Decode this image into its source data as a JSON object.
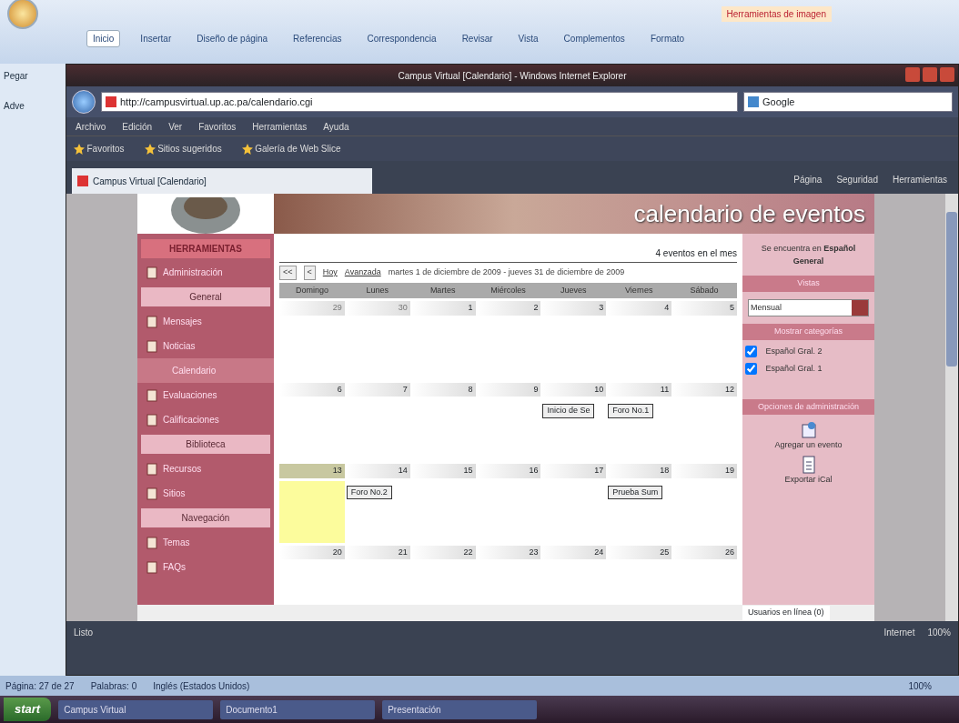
{
  "word": {
    "ribbon_tabs": [
      {
        "label": "Inicio",
        "selected": true
      },
      {
        "label": "Insertar",
        "selected": false
      },
      {
        "label": "Diseño de página",
        "selected": false
      },
      {
        "label": "Referencias",
        "selected": false
      },
      {
        "label": "Correspondencia",
        "selected": false
      },
      {
        "label": "Revisar",
        "selected": false
      },
      {
        "label": "Vista",
        "selected": false
      },
      {
        "label": "Complementos",
        "selected": false
      },
      {
        "label": "Formato",
        "selected": false
      }
    ],
    "context_tab": "Herramientas de imagen",
    "paste_label": "Pegar",
    "side_label": "Adve",
    "status": [
      "Página: 27 de 27",
      "Palabras: 0",
      "Inglés (Estados Unidos)"
    ],
    "zoom": "100%"
  },
  "ie": {
    "title": "Campus Virtual [Calendario] - Windows Internet Explorer",
    "url": "http://campusvirtual.up.ac.pa/calendario.cgi",
    "search": "Google",
    "menu": [
      "Archivo",
      "Edición",
      "Ver",
      "Favoritos",
      "Herramientas",
      "Ayuda"
    ],
    "favorites": [
      "Favoritos",
      "Sitios sugeridos",
      "Galería de Web Slice"
    ],
    "tab": "Campus Virtual [Calendario]",
    "toolbar": [
      "Página",
      "Seguridad",
      "Herramientas"
    ],
    "status": "Listo",
    "zone": "Internet",
    "zoom": "100%"
  },
  "site": {
    "header": "calendario de eventos",
    "menu_title": "HERRAMIENTAS",
    "menu": [
      {
        "kind": "item",
        "label": "Administración",
        "selected": false
      },
      {
        "kind": "section",
        "label": "General"
      },
      {
        "kind": "item",
        "label": "Mensajes",
        "selected": false
      },
      {
        "kind": "item",
        "label": "Noticias",
        "selected": false
      },
      {
        "kind": "item",
        "label": "Calendario",
        "selected": true
      },
      {
        "kind": "item",
        "label": "Evaluaciones",
        "selected": false
      },
      {
        "kind": "item",
        "label": "Calificaciones",
        "selected": false
      },
      {
        "kind": "section",
        "label": "Biblioteca"
      },
      {
        "kind": "item",
        "label": "Recursos",
        "selected": false
      },
      {
        "kind": "item",
        "label": "Sitios",
        "selected": false
      },
      {
        "kind": "section",
        "label": "Navegación"
      },
      {
        "kind": "item",
        "label": "Temas",
        "selected": false
      },
      {
        "kind": "item",
        "label": "FAQs",
        "selected": false
      }
    ],
    "event_count": "4 eventos en el mes",
    "nav_buttons": [
      "<<",
      "<"
    ],
    "today_link": "Hoy",
    "advanced_link": "Avanzada",
    "range": "martes 1 de diciembre de 2009 - jueves 31 de diciembre de 2009",
    "weekdays": [
      "Domingo",
      "Lunes",
      "Martes",
      "Miércoles",
      "Jueves",
      "Viernes",
      "Sábado"
    ],
    "weeks": [
      [
        {
          "day": "29",
          "other_month": true,
          "today": false
        },
        {
          "day": "30",
          "other_month": true,
          "today": false
        },
        {
          "day": "1",
          "other_month": false,
          "today": false
        },
        {
          "day": "2",
          "other_month": false,
          "today": false
        },
        {
          "day": "3",
          "other_month": false,
          "today": false
        },
        {
          "day": "4",
          "other_month": false,
          "today": false
        },
        {
          "day": "5",
          "other_month": false,
          "today": false
        }
      ],
      [
        {
          "day": "6",
          "other_month": false,
          "today": false
        },
        {
          "day": "7",
          "other_month": false,
          "today": false
        },
        {
          "day": "8",
          "other_month": false,
          "today": false
        },
        {
          "day": "9",
          "other_month": false,
          "today": false
        },
        {
          "day": "10",
          "other_month": false,
          "today": false,
          "events": [
            "Inicio de Se"
          ]
        },
        {
          "day": "11",
          "other_month": false,
          "today": false,
          "events": [
            "Foro No.1"
          ]
        },
        {
          "day": "12",
          "other_month": false,
          "today": false
        }
      ],
      [
        {
          "day": "13",
          "other_month": false,
          "today": true
        },
        {
          "day": "14",
          "other_month": false,
          "today": false,
          "events": [
            "Foro No.2"
          ]
        },
        {
          "day": "15",
          "other_month": false,
          "today": false
        },
        {
          "day": "16",
          "other_month": false,
          "today": false
        },
        {
          "day": "17",
          "other_month": false,
          "today": false
        },
        {
          "day": "18",
          "other_month": false,
          "today": false,
          "events": [
            "Prueba Sum"
          ]
        },
        {
          "day": "19",
          "other_month": false,
          "today": false
        }
      ],
      [
        {
          "day": "20",
          "other_month": false,
          "today": false
        },
        {
          "day": "21",
          "other_month": false,
          "today": false
        },
        {
          "day": "22",
          "other_month": false,
          "today": false
        },
        {
          "day": "23",
          "other_month": false,
          "today": false
        },
        {
          "day": "24",
          "other_month": false,
          "today": false
        },
        {
          "day": "25",
          "other_month": false,
          "today": false
        },
        {
          "day": "26",
          "other_month": false,
          "today": false
        }
      ]
    ],
    "location": "Se encuentra en **Español General**",
    "views_title": "Vistas",
    "view": "Mensual",
    "categories_title": "Mostrar categorías",
    "categories": [
      {
        "label": "Español Gral. 2",
        "checked": true
      },
      {
        "label": "Español Gral. 1",
        "checked": true
      }
    ],
    "admin_title": "Opciones de administración",
    "actions": [
      "Agregar un evento",
      "Exportar iCal"
    ],
    "online": "Usuarios en línea (0)"
  },
  "taskbar": {
    "start": "start",
    "tasks": [
      "Campus Virtual",
      "Documento1",
      "Presentación"
    ]
  }
}
